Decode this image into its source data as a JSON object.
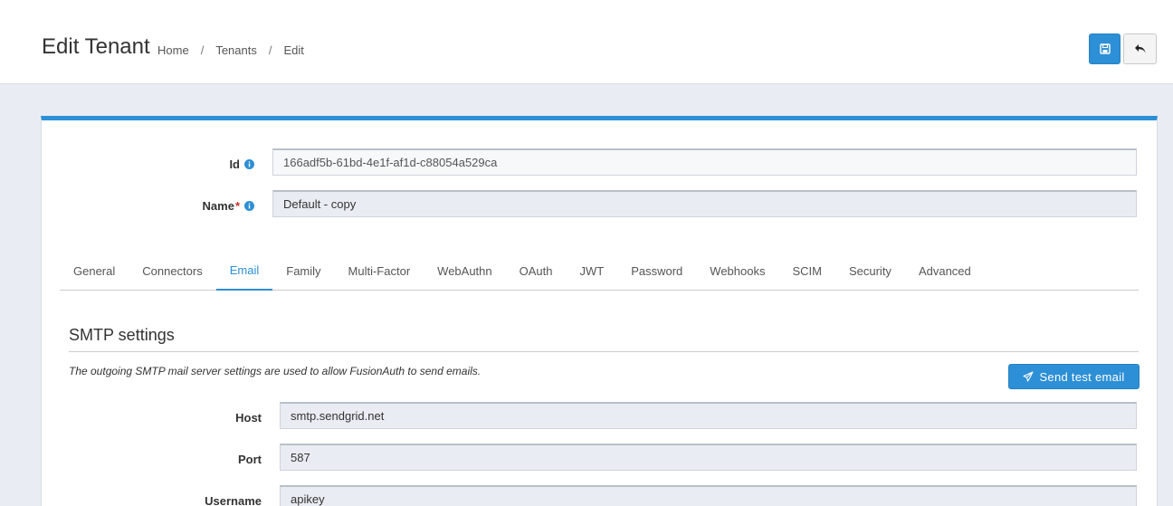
{
  "header": {
    "title": "Edit Tenant",
    "breadcrumb": [
      "Home",
      "Tenants",
      "Edit"
    ],
    "separator": "/"
  },
  "toolbar": {
    "save_icon": "floppy-disk-icon",
    "back_icon": "undo-arrow-icon"
  },
  "form": {
    "id_label": "Id",
    "id_value": "166adf5b-61bd-4e1f-af1d-c88054a529ca",
    "name_label": "Name",
    "name_required_marker": "*",
    "name_value": "Default - copy"
  },
  "tabs": [
    {
      "label": "General",
      "active": false
    },
    {
      "label": "Connectors",
      "active": false
    },
    {
      "label": "Email",
      "active": true
    },
    {
      "label": "Family",
      "active": false
    },
    {
      "label": "Multi-Factor",
      "active": false
    },
    {
      "label": "WebAuthn",
      "active": false
    },
    {
      "label": "OAuth",
      "active": false
    },
    {
      "label": "JWT",
      "active": false
    },
    {
      "label": "Password",
      "active": false
    },
    {
      "label": "Webhooks",
      "active": false
    },
    {
      "label": "SCIM",
      "active": false
    },
    {
      "label": "Security",
      "active": false
    },
    {
      "label": "Advanced",
      "active": false
    }
  ],
  "smtp": {
    "section_title": "SMTP settings",
    "description": "The outgoing SMTP mail server settings are used to allow FusionAuth to send emails.",
    "send_test_label": "Send test email",
    "host_label": "Host",
    "host_value": "smtp.sendgrid.net",
    "port_label": "Port",
    "port_value": "587",
    "username_label": "Username",
    "username_value": "apikey"
  },
  "colors": {
    "accent": "#2d8fd5",
    "background": "#e9edf3",
    "required": "#c9302c"
  }
}
